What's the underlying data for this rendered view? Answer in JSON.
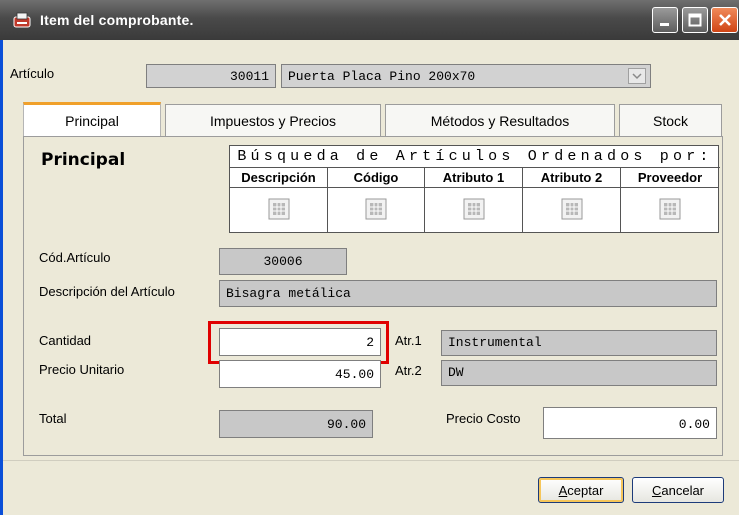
{
  "window": {
    "title": "Item del comprobante."
  },
  "articulo": {
    "label": "Artículo",
    "code": "30011",
    "description": "Puerta Placa Pino 200x70"
  },
  "tabs": [
    {
      "label": "Principal",
      "active": true
    },
    {
      "label": "Impuestos y Precios",
      "active": false
    },
    {
      "label": "Métodos y Resultados",
      "active": false
    },
    {
      "label": "Stock",
      "active": false
    }
  ],
  "panel": {
    "title": "Principal"
  },
  "search": {
    "title": "Búsqueda de Artículos Ordenados por:",
    "columns": [
      "Descripción",
      "Código",
      "Atributo 1",
      "Atributo 2",
      "Proveedor"
    ]
  },
  "form": {
    "cod_articulo_label": "Cód.Artículo",
    "cod_articulo_value": "30006",
    "descripcion_label": "Descripción del Artículo",
    "descripcion_value": "Bisagra metálica",
    "cantidad_label": "Cantidad",
    "cantidad_value": "2",
    "precio_unitario_label": "Precio Unitario",
    "precio_unitario_value": "45.00",
    "atr1_label": "Atr.1",
    "atr1_value": "Instrumental",
    "atr2_label": "Atr.2",
    "atr2_value": "DW",
    "total_label": "Total",
    "total_value": "90.00",
    "precio_costo_label": "Precio Costo",
    "precio_costo_value": "0.00"
  },
  "buttons": {
    "accept_first": "A",
    "accept_rest": "ceptar",
    "cancel_first": "C",
    "cancel_rest": "ancelar"
  },
  "colors": {
    "accent_tab": "#f0a02a",
    "highlight": "#e00000"
  }
}
